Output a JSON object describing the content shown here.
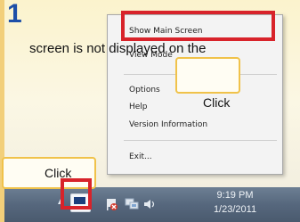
{
  "step": {
    "number": "1"
  },
  "caption": "screen is not displayed on the",
  "context_menu": {
    "items": [
      {
        "label": "Show Main Screen"
      },
      {
        "label": "View Mode"
      },
      {
        "label": "Options"
      },
      {
        "label": "Help"
      },
      {
        "label": "Version Information"
      },
      {
        "label": "Exit..."
      }
    ]
  },
  "callouts": [
    {
      "text": "Click"
    },
    {
      "text": "Click"
    }
  ],
  "taskbar": {
    "clock": {
      "time": "9:19 PM",
      "date": "1/23/2011"
    },
    "tray_icons": [
      "chevron-up-icon",
      "monitor-icon",
      "action-center-flag-icon",
      "network-icon",
      "volume-icon"
    ]
  },
  "colors": {
    "highlight": "#d8232a",
    "callout_border": "#f0c24a",
    "step_number": "#1d4fa8"
  }
}
